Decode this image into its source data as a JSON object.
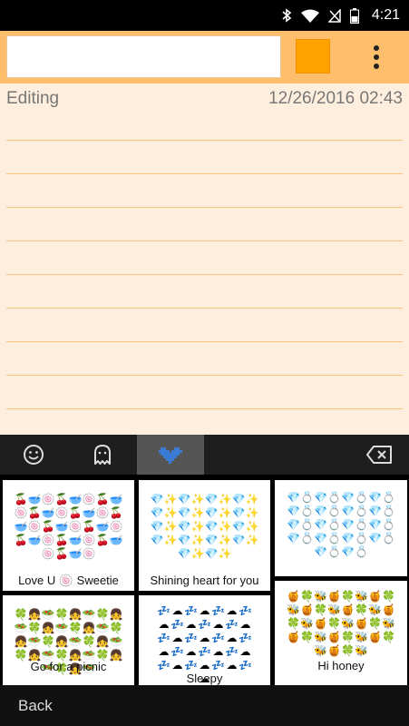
{
  "status_bar": {
    "time": "4:21",
    "icons": [
      "bluetooth-icon",
      "wifi-icon",
      "no-signal-icon",
      "battery-icon"
    ]
  },
  "toolbar": {
    "title_value": "",
    "swatch_color": "#FFA200",
    "menu_icon": "overflow-menu-icon"
  },
  "note": {
    "status": "Editing",
    "timestamp": "12/26/2016 02:43",
    "body": ""
  },
  "emoji_tabs": [
    {
      "icon": "smiley-icon",
      "active": false
    },
    {
      "icon": "ghost-icon",
      "active": false
    },
    {
      "icon": "pixel-heart-icon",
      "active": true
    },
    {
      "icon": "backspace-icon",
      "active": false
    }
  ],
  "emoji_art": [
    {
      "caption": "Love U 🍥 Sweetie",
      "glyphs": [
        "🍒",
        "🥣",
        "🍥"
      ]
    },
    {
      "caption": "Shining heart for you",
      "glyphs": [
        "💎",
        "✨"
      ]
    },
    {
      "caption": "",
      "glyphs": [
        "💎",
        "💍"
      ]
    },
    {
      "caption": "Go for a picnic",
      "glyphs": [
        "🍀",
        "👧",
        "🥗"
      ]
    },
    {
      "caption": "Sleepy",
      "glyphs": [
        "💤",
        "☁"
      ]
    },
    {
      "caption": "Hi honey",
      "glyphs": [
        "🍯",
        "🍀",
        "🐝"
      ]
    }
  ],
  "bottom_bar": {
    "back_label": "Back"
  }
}
